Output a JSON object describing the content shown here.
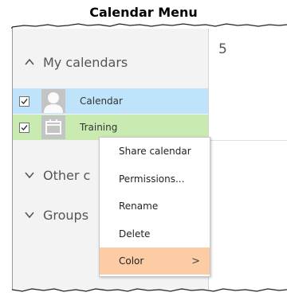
{
  "caption": "Calendar Menu",
  "main": {
    "day_number": "5"
  },
  "sidebar": {
    "sections": [
      {
        "label": "My calendars",
        "expanded": true,
        "icon": "chevron-up-icon"
      },
      {
        "label": "Other c",
        "expanded": false,
        "icon": "chevron-down-icon"
      },
      {
        "label": "Groups",
        "expanded": false,
        "icon": "chevron-down-icon"
      }
    ],
    "calendars": [
      {
        "label": "Calendar",
        "checked": true,
        "icon": "person-avatar-icon",
        "color": "#bfe3fb"
      },
      {
        "label": "Training",
        "checked": true,
        "icon": "calendar-icon",
        "color": "#c9ebb1"
      }
    ]
  },
  "context_menu": {
    "items": [
      {
        "label": "Share calendar"
      },
      {
        "label": "Permissions..."
      },
      {
        "label": "Rename"
      },
      {
        "label": "Delete"
      },
      {
        "label": "Color",
        "has_submenu": true,
        "highlighted": true,
        "submenu_glyph": ">"
      }
    ],
    "highlight_color": "#fccca5"
  }
}
